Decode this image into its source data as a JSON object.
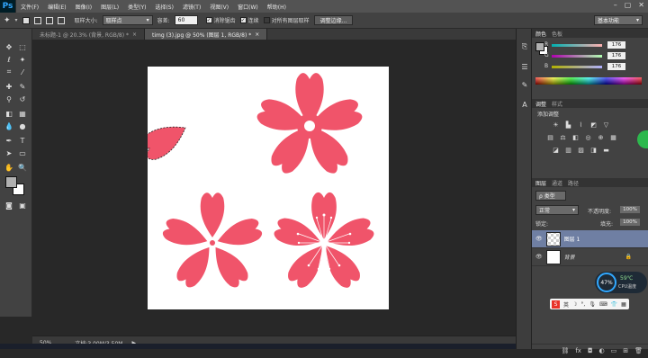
{
  "app": {
    "logo": "Ps"
  },
  "menu": [
    "文件(F)",
    "编辑(E)",
    "图像(I)",
    "图层(L)",
    "类型(Y)",
    "选择(S)",
    "滤镜(T)",
    "视图(V)",
    "窗口(W)",
    "帮助(H)"
  ],
  "window_controls": [
    "–",
    "▢",
    "✕"
  ],
  "options": {
    "sample_size_label": "取样大小:",
    "sample_size_value": "取样点",
    "tolerance_label": "容差:",
    "tolerance_value": "60",
    "antialias_label": "消除锯齿",
    "contiguous_label": "连续",
    "sample_all_label": "对所有图层取样",
    "refine_edge_label": "调整边缘...",
    "workspace_value": "基本功能"
  },
  "tabs": [
    {
      "label": "未标题-1 @ 20.3% (背景, RGB/8) *",
      "close": "×"
    },
    {
      "label": "timg (3).jpg @ 50% (图层 1, RGB/8) *",
      "close": "×"
    }
  ],
  "status": {
    "zoom": "50%",
    "doc": "文档:3.00M/3.50M",
    "arrow": "▶"
  },
  "color_panel": {
    "tabs": [
      "颜色",
      "色板"
    ],
    "channels": [
      {
        "label": "R",
        "value": "176"
      },
      {
        "label": "G",
        "value": "176"
      },
      {
        "label": "B",
        "value": "176"
      }
    ]
  },
  "adjust_panel": {
    "tabs": [
      "调整",
      "样式"
    ],
    "title": "添加调整"
  },
  "layers_panel": {
    "tabs": [
      "图层",
      "通道",
      "路径"
    ],
    "kind": "ρ 类型",
    "blend_mode": "正常",
    "opacity_label": "不透明度:",
    "opacity_value": "100%",
    "lock_label": "锁定:",
    "fill_label": "填充:",
    "fill_value": "100%",
    "layers": [
      {
        "name": "图层 1",
        "selected": true
      },
      {
        "name": "背景",
        "selected": false
      }
    ]
  },
  "cpu_widget": {
    "percent": "47%",
    "temp": "59℃",
    "label": "CPU温度"
  },
  "ime": {
    "label": "英"
  },
  "colors": {
    "flower": "#f0546a",
    "accent_blue": "#31a8ff"
  }
}
